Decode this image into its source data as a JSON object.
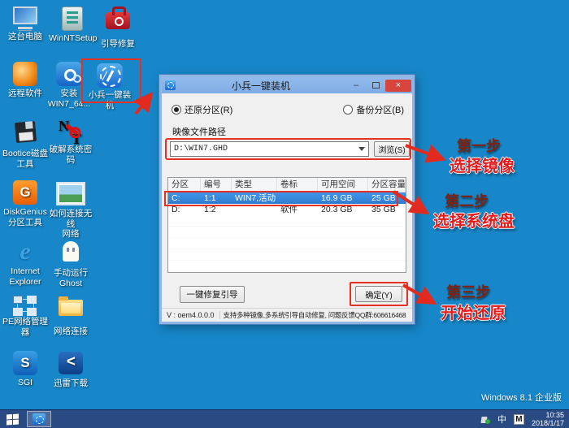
{
  "desktop": {
    "icons": [
      {
        "label": "这台电脑"
      },
      {
        "label": "WinNTSetup"
      },
      {
        "label": "引导修复"
      },
      {
        "label": "远程软件"
      },
      {
        "label": "安装",
        "label2": "WIN7_64..."
      },
      {
        "label": "小兵一键装机"
      },
      {
        "label": "Bootice磁盘",
        "label2": "工具"
      },
      {
        "label": "破解系统密码"
      },
      {
        "label": "DiskGenius",
        "label2": "分区工具"
      },
      {
        "label": "如何连接无线",
        "label2": "网络"
      },
      {
        "label": "Internet",
        "label2": "Explorer"
      },
      {
        "label": "手动运行",
        "label2": "Ghost"
      },
      {
        "label": "PE网络管理器"
      },
      {
        "label": "网络连接"
      },
      {
        "label": "SGI"
      },
      {
        "label": "迅雷下载"
      }
    ],
    "os_label": "Windows 8.1 企业版"
  },
  "dialog": {
    "title": "小兵一键装机",
    "radio_restore": "还原分区(R)",
    "radio_backup": "备份分区(B)",
    "path_label": "映像文件路径",
    "path_value": "D:\\WIN7.GHD",
    "browse_label": "浏览(S)",
    "table": {
      "headers": [
        "分区",
        "编号",
        "类型",
        "卷标",
        "可用空间",
        "分区容量"
      ],
      "rows": [
        [
          "C:",
          "1:1",
          "WIN7,活动",
          "",
          "16.9 GB",
          "25 GB"
        ],
        [
          "D:",
          "1:2",
          "",
          "软件",
          "20.3 GB",
          "35 GB"
        ]
      ]
    },
    "repair_button": "一键修复引导",
    "ok_button": "确定(Y)",
    "version": "V : oem4.0.0.0",
    "status": "支持多种镜像,多系统引导自动修复, 问题反馈QQ群:606616468"
  },
  "annotations": {
    "steps": [
      {
        "title": "第一步",
        "action": "选择镜像"
      },
      {
        "title": "第二步",
        "action": "选择系统盘"
      },
      {
        "title": "第三步",
        "action": "开始还原"
      }
    ],
    "accent_red": "#E53022"
  },
  "taskbar": {
    "time": "10:35",
    "date": "2018/1/17",
    "ime_lang": "中",
    "ime_mode": "M"
  }
}
